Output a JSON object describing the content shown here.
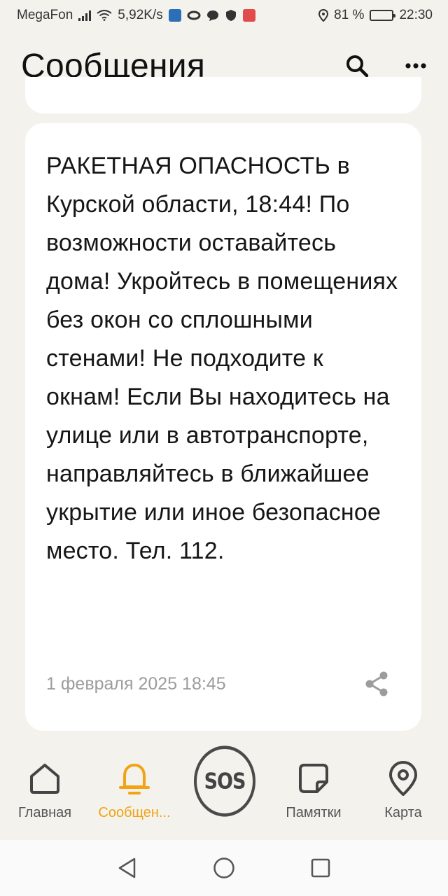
{
  "status_bar": {
    "carrier": "MegaFon",
    "net_speed": "5,92K/s",
    "battery_percent": "81 %",
    "battery_level": 0.81,
    "time": "22:30"
  },
  "header": {
    "title": "Сообщения",
    "search_icon": "search-icon",
    "more_icon": "more-icon"
  },
  "message": {
    "text": "РАКЕТНАЯ ОПАСНОСТЬ в Курской области, 18:44! По возможности оставайтесь дома! Укройтесь в помещениях без окон со сплошными стенами! Не подходите к окнам! Если Вы находитесь на улице или в автотранспорте, направляйтесь в ближайшее укрытие или иное безопасное место. Тел. 112.",
    "date": "1 февраля 2025 18:45"
  },
  "bottom_nav": {
    "items": [
      {
        "label": "Главная",
        "icon": "home-icon"
      },
      {
        "label": "Сообщен...",
        "icon": "bell-icon",
        "active": true
      },
      {
        "label": "SOS",
        "icon": "sos-icon"
      },
      {
        "label": "Памятки",
        "icon": "note-icon"
      },
      {
        "label": "Карта",
        "icon": "map-pin-icon"
      }
    ]
  },
  "colors": {
    "background": "#f3f2ed",
    "card": "#ffffff",
    "accent": "#f2a314",
    "muted": "#9c9c9c"
  }
}
